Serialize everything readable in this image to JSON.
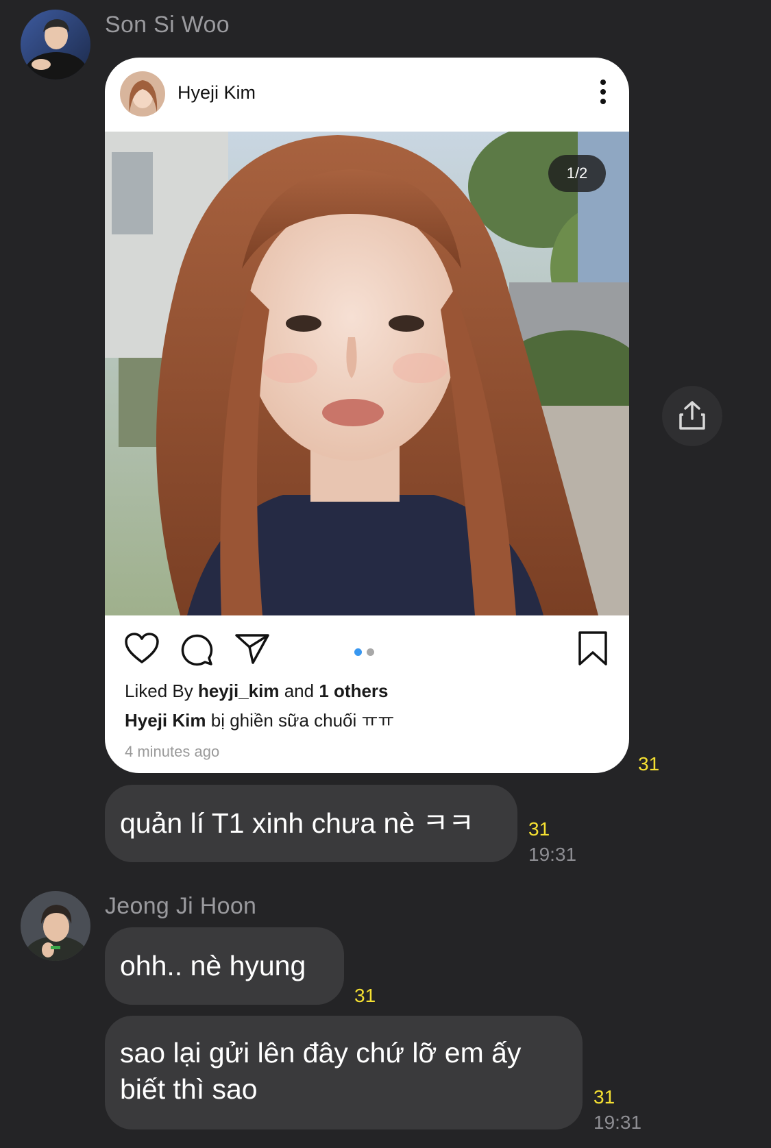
{
  "messages": {
    "sender1": {
      "name": "Son Si Woo"
    },
    "ig_post": {
      "username": "Hyeji Kim",
      "counter": "1/2",
      "likes_prefix": "Liked By",
      "likes_user": "heyji_kim",
      "likes_and": "and",
      "likes_others": "1 others",
      "caption_user": "Hyeji Kim",
      "caption_text": "bị ghiền sữa chuối ㅠㅠ",
      "time_ago": "4 minutes ago",
      "dot_active_color": "#3897f0",
      "dot_inactive_color": "#a8a8a8",
      "unread": "31"
    },
    "msg1": {
      "text": "quản lí T1 xinh chưa nè ㅋㅋ",
      "unread": "31",
      "time": "19:31"
    },
    "sender2": {
      "name": "Jeong Ji Hoon"
    },
    "msg2": {
      "text": "ohh.. nè hyung",
      "unread": "31"
    },
    "msg3": {
      "line1": "sao lại gửi lên đây chứ lỡ em ấy",
      "line2": "biết thì sao",
      "unread": "31",
      "time": "19:31"
    }
  },
  "colors": {
    "background": "#242426",
    "bubble": "#3a3a3c",
    "unread": "#f5e032",
    "name": "#9a9a9e"
  },
  "icons": {
    "share": "share-icon",
    "heart": "heart-icon",
    "comment": "comment-icon",
    "send": "send-icon",
    "bookmark": "bookmark-icon",
    "more": "more-vertical-icon"
  }
}
